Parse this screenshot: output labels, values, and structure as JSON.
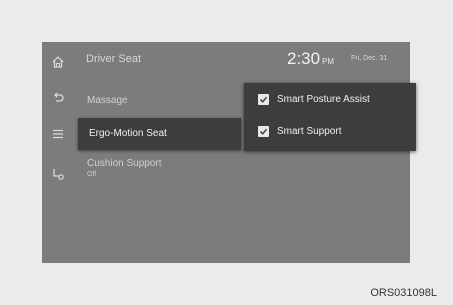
{
  "header": {
    "title": "Driver Seat",
    "time": "2:30",
    "ampm": "PM",
    "date": "Fri, Dec. 31"
  },
  "leftbar": {
    "icons": [
      "home-icon",
      "back-icon",
      "menu-icon",
      "seat-settings-icon"
    ]
  },
  "menu": {
    "items": [
      {
        "label": "Massage"
      },
      {
        "label": "Ergo-Motion Seat",
        "selected": true
      },
      {
        "label": "Cushion Support",
        "value": "Off"
      }
    ]
  },
  "popup": {
    "options": [
      {
        "label": "Smart Posture Assist",
        "checked": true
      },
      {
        "label": "Smart Support",
        "checked": true
      }
    ]
  },
  "caption": "ORS031098L"
}
